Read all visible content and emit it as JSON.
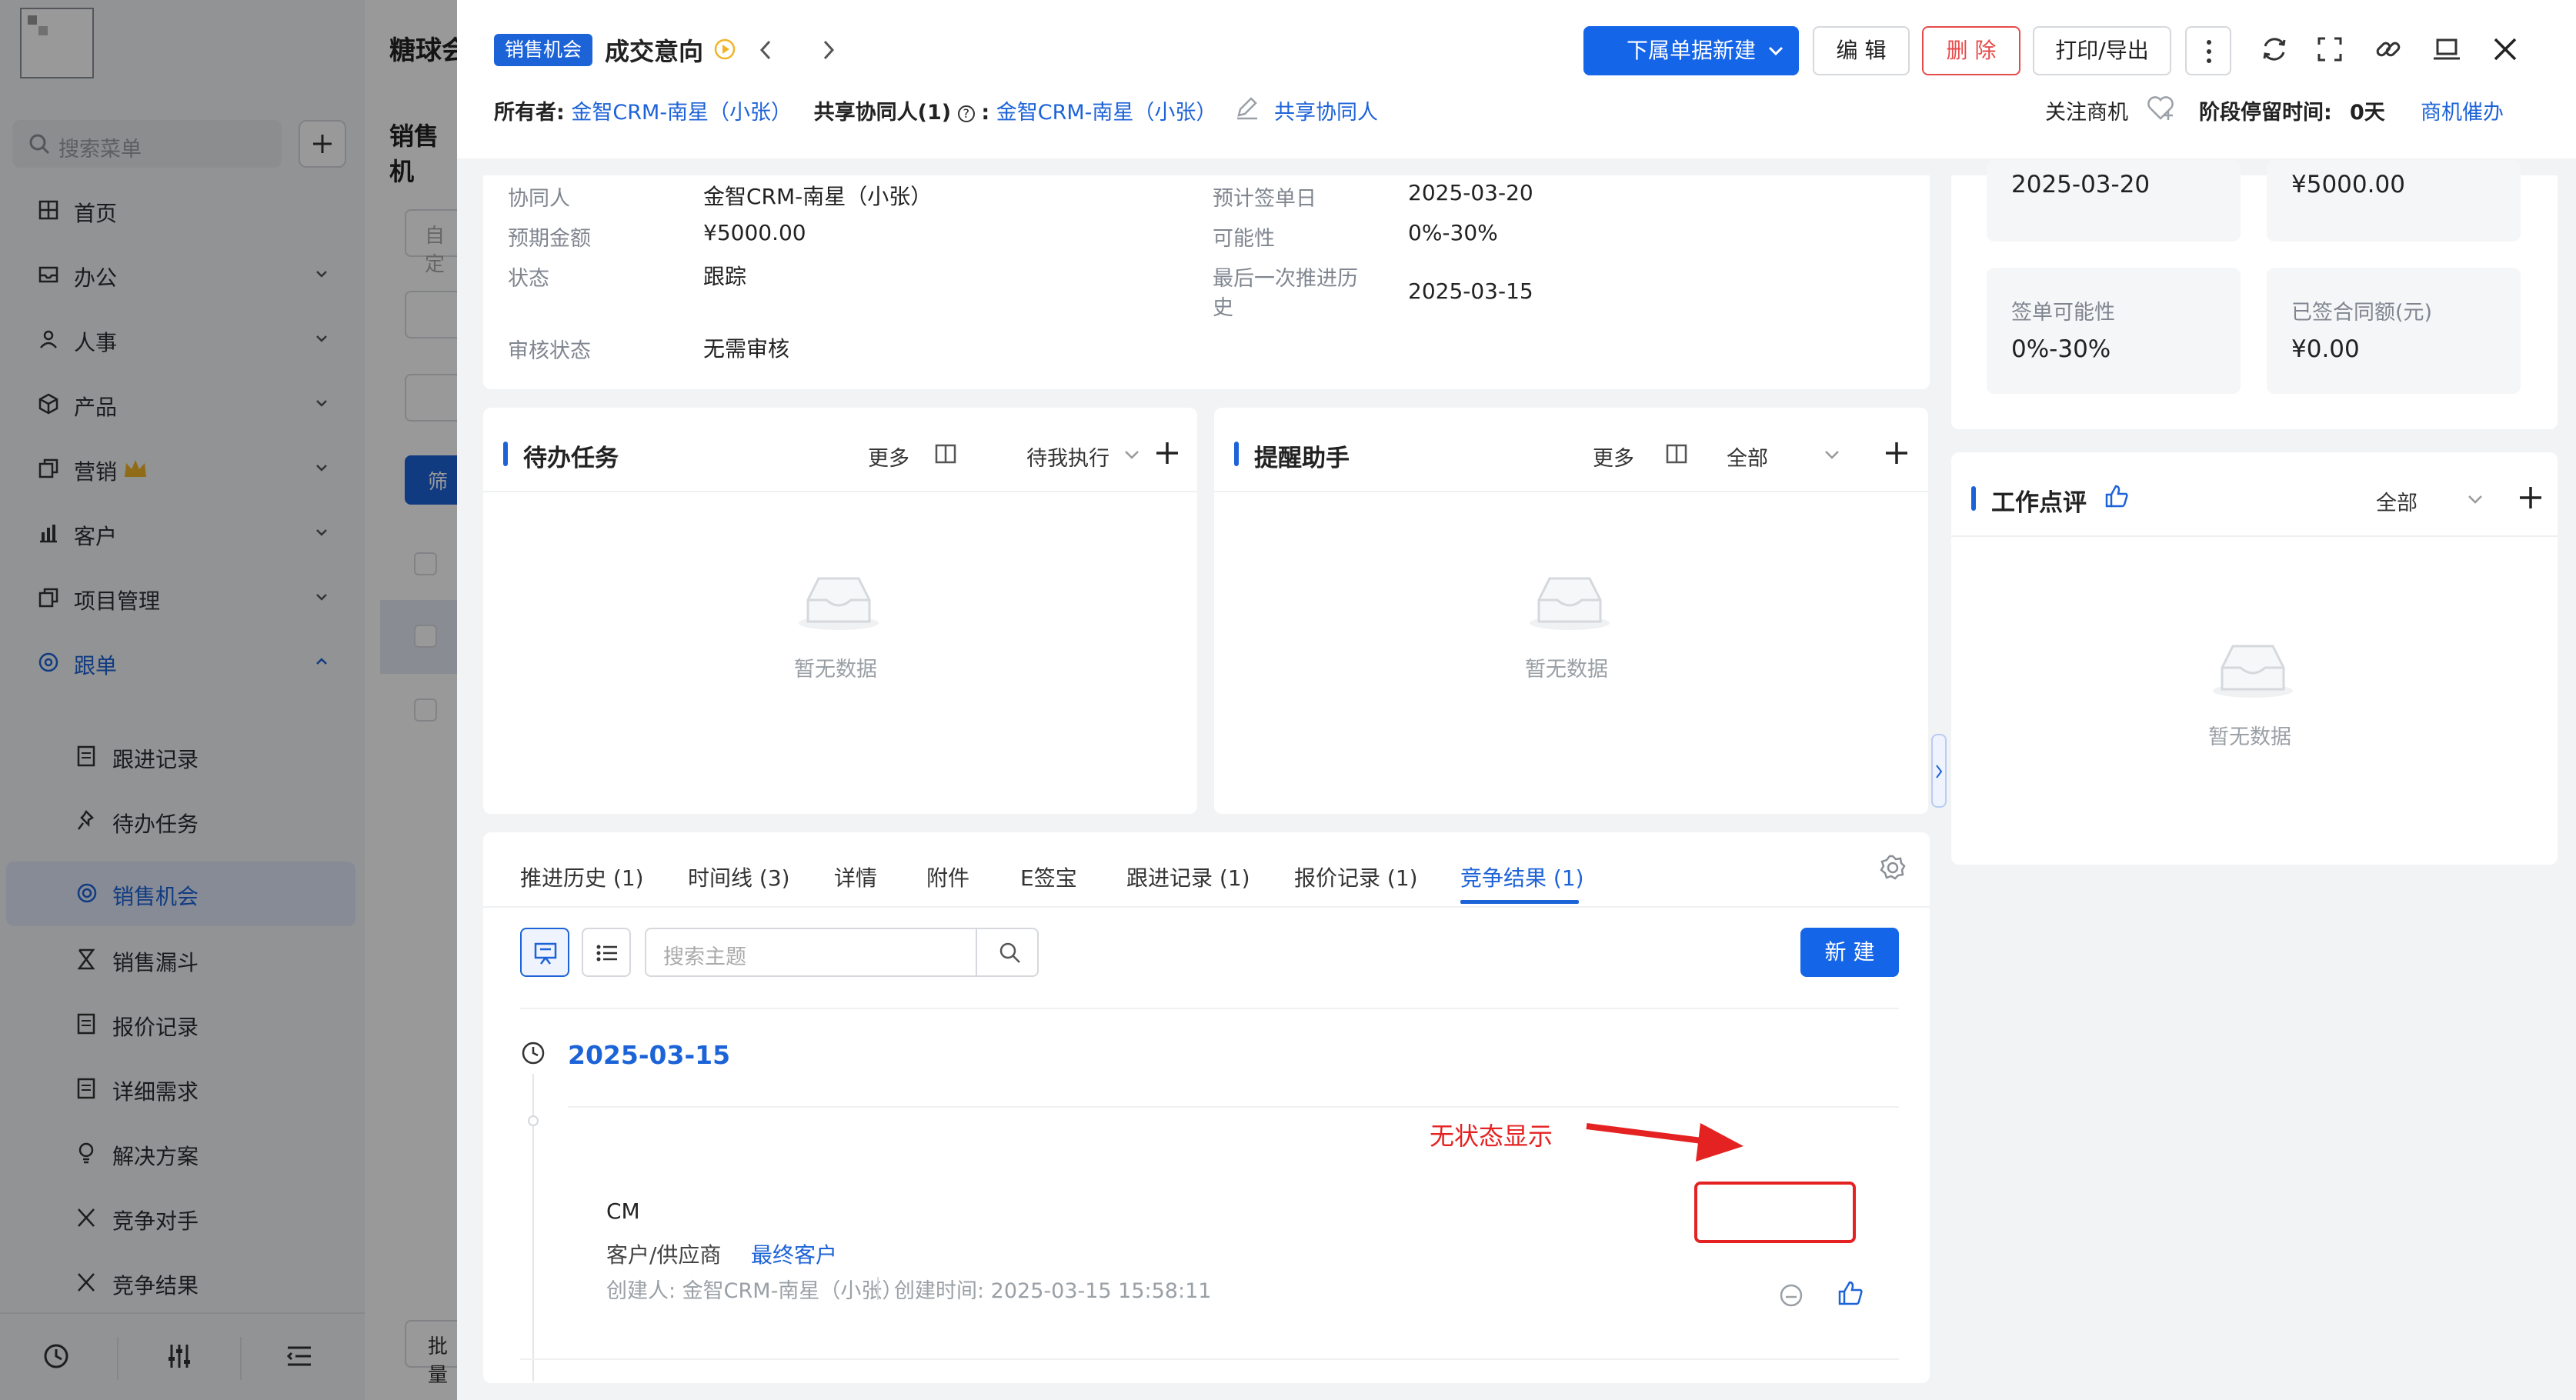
{
  "app": {
    "title": "糖球会",
    "sub_title": "销售机",
    "search_placeholder": "搜索菜单",
    "filter_placeholder": "自定",
    "filter_button": "筛",
    "batch_button": "批量",
    "menu": [
      {
        "label": "首页"
      },
      {
        "label": "办公"
      },
      {
        "label": "人事"
      },
      {
        "label": "产品"
      },
      {
        "label": "营销"
      },
      {
        "label": "客户"
      },
      {
        "label": "项目管理"
      },
      {
        "label": "跟单"
      }
    ],
    "submenu": [
      {
        "label": "跟进记录"
      },
      {
        "label": "待办任务"
      },
      {
        "label": "销售机会"
      },
      {
        "label": "销售漏斗"
      },
      {
        "label": "报价记录"
      },
      {
        "label": "详细需求"
      },
      {
        "label": "解决方案"
      },
      {
        "label": "竞争对手"
      },
      {
        "label": "竞争结果"
      }
    ]
  },
  "header": {
    "tag": "销售机会",
    "title": "成交意向",
    "owner_label": "所有者:",
    "owner_value": "金智CRM-南星（小张）",
    "share_label": "共享协同人(1)",
    "share_colon": ":",
    "share_value": "金智CRM-南星（小张）",
    "share_action": "共享协同人",
    "follow_label": "关注商机",
    "stay_label": "阶段停留时间:",
    "stay_value": "0天",
    "urge_link": "商机催办",
    "buttons": {
      "new_sub": "下属单据新建",
      "edit": "编 辑",
      "delete": "删 除",
      "print": "打印/导出"
    }
  },
  "info": {
    "fields_left": [
      {
        "label": "协同人",
        "value": "金智CRM-南星（小张）"
      },
      {
        "label": "预期金额",
        "value": "¥5000.00"
      },
      {
        "label": "状态",
        "value": "跟踪"
      },
      {
        "label": "审核状态",
        "value": "无需审核"
      }
    ],
    "fields_right": [
      {
        "label": "预计签单日",
        "value": "2025-03-20"
      },
      {
        "label": "可能性",
        "value": "0%-30%"
      },
      {
        "label": "最后一次推进历",
        "label2": "史",
        "value": "2025-03-15"
      }
    ]
  },
  "stats": [
    {
      "label": "",
      "value": "2025-03-20"
    },
    {
      "label": "",
      "value": "¥5000.00"
    },
    {
      "label": "签单可能性",
      "value": "0%-30%"
    },
    {
      "label": "已签合同额(元)",
      "value": "¥0.00"
    }
  ],
  "todo_panel": {
    "title": "待办任务",
    "more": "更多",
    "filter": "待我执行",
    "empty": "暂无数据"
  },
  "remind_panel": {
    "title": "提醒助手",
    "more": "更多",
    "filter": "全部",
    "empty": "暂无数据"
  },
  "review_panel": {
    "title": "工作点评",
    "filter": "全部",
    "empty": "暂无数据"
  },
  "tabs": [
    {
      "label": "推进历史 (1)"
    },
    {
      "label": "时间线 (3)"
    },
    {
      "label": "详情"
    },
    {
      "label": "附件"
    },
    {
      "label": "E签宝"
    },
    {
      "label": "跟进记录 (1)"
    },
    {
      "label": "报价记录 (1)"
    },
    {
      "label": "竞争结果 (1)"
    }
  ],
  "list": {
    "search_placeholder": "搜索主题",
    "new_button": "新 建",
    "date": "2025-03-15",
    "record": {
      "name": "CM",
      "type_label": "客户/供应商",
      "type_value": "最终客户",
      "creator": "创建人: 金智CRM-南星（小张）",
      "created_time": "创建时间: 2025-03-15 15:58:11"
    },
    "annotation": "无状态显示"
  },
  "colors": {
    "accent": "#1d63d8",
    "danger": "#e84b4b",
    "annotation": "#e52222"
  }
}
